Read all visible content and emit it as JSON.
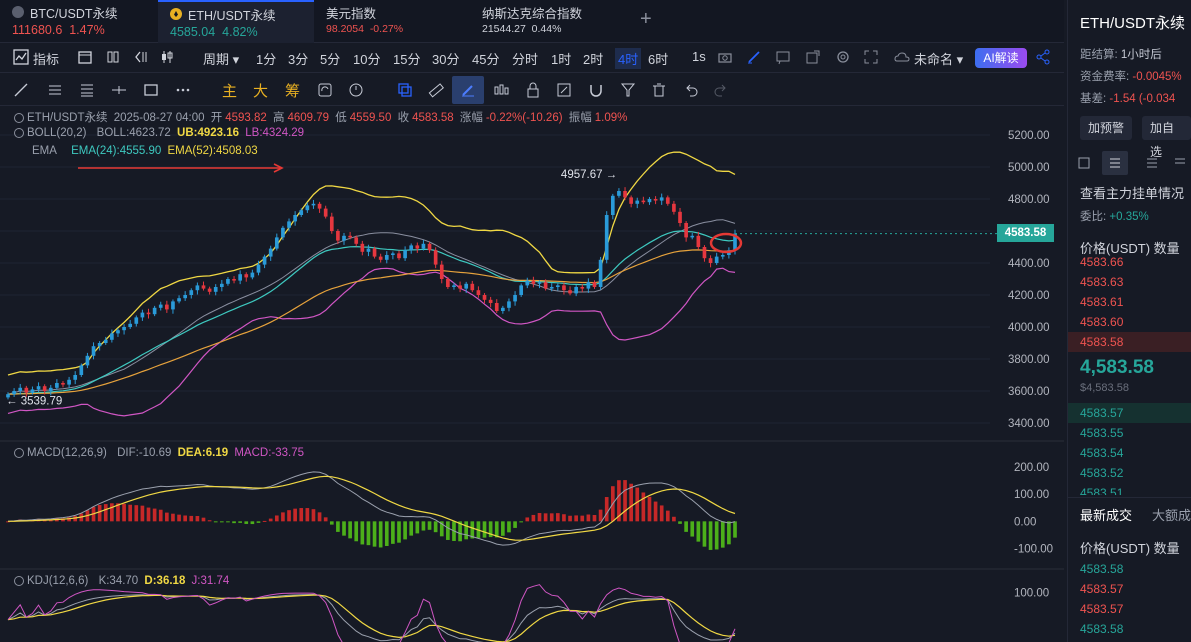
{
  "tabs": [
    {
      "name": "BTC/USDT永续",
      "price": "111680.6",
      "change": "1.47%",
      "dir": "dn"
    },
    {
      "name": "ETH/USDT永续",
      "price": "4585.04",
      "change": "4.82%",
      "dir": "up"
    },
    {
      "name": "美元指数",
      "price": "98.2054",
      "change": "-0.27%",
      "dir": "dn"
    },
    {
      "name": "纳斯达克综合指数",
      "price": "21544.27",
      "change": "0.44%",
      "dir": "neutral"
    }
  ],
  "toolbar": {
    "indicator_label": "指标",
    "period_label": "周期",
    "intervals": [
      "1分",
      "3分",
      "5分",
      "10分",
      "15分",
      "30分",
      "45分",
      "分时",
      "1时",
      "2时",
      "4时",
      "6时",
      "1s"
    ],
    "active_interval": "4时",
    "layout_name": "未命名",
    "ai_label": "AI解读"
  },
  "drawing_toolbar": {
    "text_tools": [
      "主",
      "大",
      "筹"
    ]
  },
  "legend": {
    "symbol": "ETH/USDT永续",
    "datetime": "2025-08-27 04:00",
    "open_label": "开",
    "open": "4593.82",
    "high_label": "高",
    "high": "4609.79",
    "low_label": "低",
    "low": "4559.50",
    "close_label": "收",
    "close": "4583.58",
    "change_label": "涨幅",
    "change": "-0.22%(-10.26)",
    "amp_label": "振幅",
    "amp": "1.09%",
    "boll_name": "BOLL(20,2)",
    "boll_mid": "BOLL:4623.72",
    "boll_ub": "UB:4923.16",
    "boll_lb": "LB:4324.29",
    "ema_name": "EMA",
    "ema24": "EMA(24):4555.90",
    "ema52": "EMA(52):4508.03",
    "macd_name": "MACD(12,26,9)",
    "dif": "DIF:-10.69",
    "dea": "DEA:6.19",
    "macd": "MACD:-33.75",
    "kdj_name": "KDJ(12,6,6)",
    "k": "K:34.70",
    "d": "D:36.18",
    "j": "J:31.74"
  },
  "price_axis": [
    "5200.00",
    "5000.00",
    "4800.00",
    "4600.00",
    "4400.00",
    "4200.00",
    "4000.00",
    "3800.00",
    "3600.00",
    "3400.00"
  ],
  "macd_axis": [
    "200.00",
    "100.00",
    "0.00",
    "-100.00"
  ],
  "kdj_axis": [
    "100.00"
  ],
  "current_price_tag": "4583.58",
  "annotations": {
    "high": "4957.67",
    "low": "3539.79"
  },
  "chart_data": {
    "type": "candlestick",
    "symbol": "ETH/USDT永续",
    "interval": "4时",
    "ylim": [
      3400,
      5200
    ],
    "closes": [
      3580,
      3600,
      3620,
      3590,
      3610,
      3630,
      3600,
      3620,
      3650,
      3640,
      3670,
      3700,
      3760,
      3820,
      3880,
      3900,
      3920,
      3960,
      3980,
      4000,
      4020,
      4060,
      4090,
      4080,
      4120,
      4140,
      4110,
      4160,
      4180,
      4200,
      4230,
      4260,
      4240,
      4220,
      4250,
      4270,
      4300,
      4290,
      4330,
      4310,
      4340,
      4390,
      4440,
      4490,
      4560,
      4620,
      4660,
      4700,
      4730,
      4760,
      4770,
      4740,
      4690,
      4600,
      4540,
      4570,
      4560,
      4520,
      4470,
      4490,
      4440,
      4420,
      4450,
      4460,
      4430,
      4480,
      4510,
      4490,
      4520,
      4480,
      4390,
      4300,
      4250,
      4260,
      4240,
      4270,
      4230,
      4200,
      4170,
      4150,
      4100,
      4120,
      4160,
      4200,
      4260,
      4290,
      4270,
      4280,
      4240,
      4250,
      4260,
      4230,
      4210,
      4250,
      4240,
      4280,
      4250,
      4420,
      4700,
      4820,
      4850,
      4810,
      4770,
      4790,
      4780,
      4800,
      4790,
      4810,
      4770,
      4720,
      4650,
      4560,
      4570,
      4500,
      4430,
      4400,
      4440,
      4450,
      4480,
      4583.58
    ],
    "boll": {
      "ub": "4923.16",
      "mid": "4623.72",
      "lb": "4324.29"
    },
    "ema24": "4555.90",
    "ema52": "4508.03",
    "macd": {
      "dif": -10.69,
      "dea": 6.19,
      "hist": -33.75,
      "ylim": [
        -150,
        230
      ]
    },
    "kdj": {
      "k": 34.7,
      "d": 36.18,
      "j": 31.74
    }
  },
  "right_panel": {
    "title": "ETH/USDT永续",
    "settle_label": "距结算",
    "settle": "1小时后",
    "funding_label": "资金费率:",
    "funding": "-0.0045%",
    "basis_label": "基差:",
    "basis": "-1.54 (-0.034",
    "alert_btn": "加预警",
    "fav_btn": "加自选",
    "depth_title": "查看主力挂单情况",
    "ratio_label": "委比:",
    "ratio": "+0.35%",
    "ob_header": "价格(USDT) 数量",
    "asks": [
      "4583.66",
      "4583.63",
      "4583.61",
      "4583.60",
      "4583.58"
    ],
    "last_price": "4,583.58",
    "last_usd": "$4,583.58",
    "bids": [
      "4583.57",
      "4583.55",
      "4583.54",
      "4583.52",
      "4583.51"
    ],
    "trades_tab": "最新成交",
    "bigtrades_tab": "大额成",
    "trades_header": "价格(USDT) 数量",
    "trades": [
      {
        "price": "4583.58",
        "side": "bid"
      },
      {
        "price": "4583.57",
        "side": "ask"
      },
      {
        "price": "4583.57",
        "side": "ask"
      },
      {
        "price": "4583.58",
        "side": "bid"
      }
    ]
  }
}
